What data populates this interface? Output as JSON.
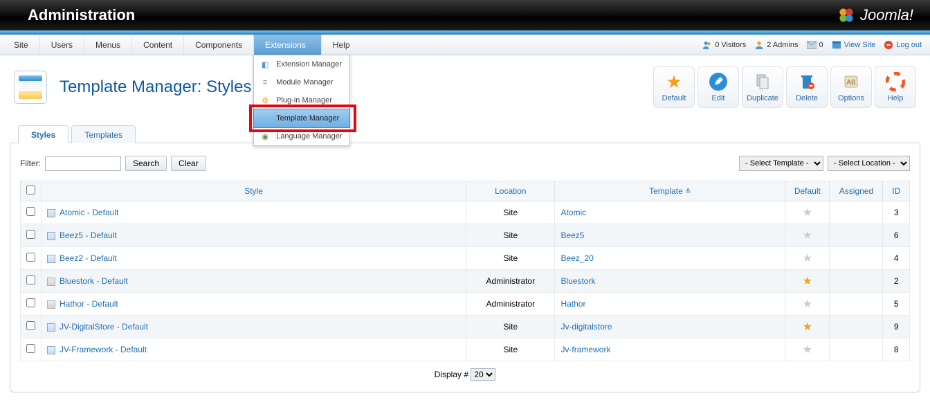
{
  "header": {
    "title": "Administration",
    "brand": "Joomla!"
  },
  "menubar": {
    "items": [
      "Site",
      "Users",
      "Menus",
      "Content",
      "Components",
      "Extensions",
      "Help"
    ],
    "open_index": 5,
    "dropdown": {
      "items": [
        {
          "label": "Extension Manager",
          "icon": "puzzle"
        },
        {
          "label": "Module Manager",
          "icon": "stack"
        },
        {
          "label": "Plug-in Manager",
          "icon": "plug"
        },
        {
          "label": "Template Manager",
          "icon": "template",
          "highlight": true
        },
        {
          "label": "Language Manager",
          "icon": "globe"
        }
      ]
    }
  },
  "status": {
    "visitors": {
      "label": "0 Visitors",
      "icon": "users"
    },
    "admins": {
      "label": "2 Admins",
      "icon": "user"
    },
    "messages": {
      "label": "0",
      "icon": "mail"
    },
    "view_site": {
      "label": "View Site",
      "icon": "window"
    },
    "logout": {
      "label": "Log out",
      "icon": "stop"
    }
  },
  "page": {
    "title": "Template Manager: Styles"
  },
  "toolbar": [
    {
      "name": "default-button",
      "label": "Default",
      "icon": "star",
      "color": "#f4a118"
    },
    {
      "name": "edit-button",
      "label": "Edit",
      "icon": "pencil",
      "color": "#2a8fdb"
    },
    {
      "name": "duplicate-button",
      "label": "Duplicate",
      "icon": "copy",
      "color": "#b7c0c7"
    },
    {
      "name": "delete-button",
      "label": "Delete",
      "icon": "trash",
      "color": "#2d86c9"
    },
    {
      "name": "options-button",
      "label": "Options",
      "icon": "sliders",
      "color": "#c7b279"
    },
    {
      "name": "help-button",
      "label": "Help",
      "icon": "lifebuoy",
      "color": "#f05a2a"
    }
  ],
  "tabs": {
    "items": [
      "Styles",
      "Templates"
    ],
    "active": 0
  },
  "filter": {
    "label": "Filter:",
    "value": "",
    "search": "Search",
    "clear": "Clear",
    "selects": [
      "- Select Template -",
      "- Select Location -"
    ]
  },
  "table": {
    "columns": {
      "checkbox": "",
      "style": "Style",
      "location": "Location",
      "template": "Template",
      "default": "Default",
      "assigned": "Assigned",
      "id": "ID"
    },
    "sort_triangle_on": "template",
    "rows": [
      {
        "style": "Atomic - Default",
        "loc": "Site",
        "tpl": "Atomic",
        "def": false,
        "id": 3,
        "site": true
      },
      {
        "style": "Beez5 - Default",
        "loc": "Site",
        "tpl": "Beez5",
        "def": false,
        "id": 6,
        "site": true
      },
      {
        "style": "Beez2 - Default",
        "loc": "Site",
        "tpl": "Beez_20",
        "def": false,
        "id": 4,
        "site": true
      },
      {
        "style": "Bluestork - Default",
        "loc": "Administrator",
        "tpl": "Bluestork",
        "def": true,
        "id": 2,
        "site": false
      },
      {
        "style": "Hathor - Default",
        "loc": "Administrator",
        "tpl": "Hathor",
        "def": false,
        "id": 5,
        "site": false
      },
      {
        "style": "JV-DigitalStore - Default",
        "loc": "Site",
        "tpl": "Jv-digitalstore",
        "def": true,
        "id": 9,
        "site": true
      },
      {
        "style": "JV-Framework - Default",
        "loc": "Site",
        "tpl": "Jv-framework",
        "def": false,
        "id": 8,
        "site": true
      }
    ]
  },
  "display": {
    "label": "Display #",
    "value": "20"
  }
}
